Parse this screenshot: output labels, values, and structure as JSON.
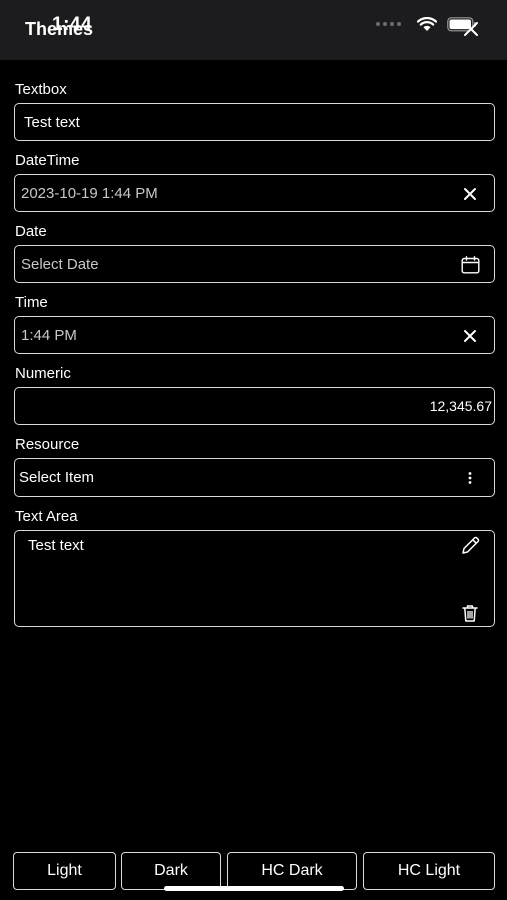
{
  "status": {
    "time": "1:44"
  },
  "header": {
    "title": "Themes"
  },
  "form": {
    "textbox": {
      "label": "Textbox",
      "value": "Test text"
    },
    "datetime": {
      "label": "DateTime",
      "value": "2023-10-19 1:44 PM"
    },
    "date": {
      "label": "Date",
      "placeholder": "Select Date"
    },
    "time": {
      "label": "Time",
      "value": "1:44 PM"
    },
    "numeric": {
      "label": "Numeric",
      "value": "12,345.67"
    },
    "resource": {
      "label": "Resource",
      "value": "Select Item"
    },
    "text_area": {
      "label": "Text Area",
      "value": "Test text"
    }
  },
  "themes": {
    "light": "Light",
    "dark": "Dark",
    "hc_dark": "HC Dark",
    "hc_light": "HC Light"
  },
  "colors": {
    "background": "#000000",
    "header": "#1c1c1e",
    "border": "#d9d9d9",
    "text": "#ffffff"
  },
  "icons": [
    "wifi-icon",
    "battery-icon",
    "close-icon",
    "clear-icon",
    "calendar-icon",
    "more-vertical-icon",
    "pencil-icon",
    "trash-icon"
  ]
}
